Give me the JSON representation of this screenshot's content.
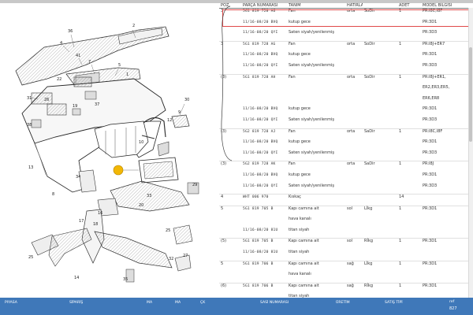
{
  "diagram": {
    "callouts": [
      "36",
      "4",
      "41",
      "7",
      "2",
      "22",
      "5",
      "1",
      "31",
      "26",
      "37",
      "19",
      "30",
      "9",
      "38",
      "12",
      "10",
      "13",
      "8",
      "34",
      "33",
      "29",
      "20",
      "17",
      "16",
      "18",
      "25",
      "25",
      "32",
      "27",
      "14",
      "35"
    ]
  },
  "table": {
    "headers": [
      "POZ.",
      "PARÇA NUMARASI",
      "TANIM",
      "HATIRLATMA",
      "",
      "ADET",
      "MODEL BİLGİSİ"
    ],
    "rows": [
      {
        "poz": "3",
        "part": "5G1 819 728 AG",
        "desc": "Fan",
        "color": "orta",
        "variant": "SoDir",
        "qty": "1",
        "model": "PR:I8C,I8F"
      },
      {
        "poz": "",
        "part": "11/16-08/20 BVQ",
        "desc": "kutup gece",
        "color": "",
        "variant": "",
        "qty": "",
        "model": "PR:3D1"
      },
      {
        "poz": "",
        "part": "11/16-08/20 QYI",
        "desc": "Saten siyah/yenilenmiş",
        "color": "",
        "variant": "",
        "qty": "",
        "model": "PR:3D3"
      },
      {
        "poz": "3",
        "part": "5G1 819 728 AG",
        "desc": "Fan",
        "color": "orta",
        "variant": "SoDir",
        "qty": "1",
        "model": "PR:I8J+ER7"
      },
      {
        "poz": "",
        "part": "11/16-08/20 BVQ",
        "desc": "kutup gece",
        "color": "",
        "variant": "",
        "qty": "",
        "model": "PR:3D1"
      },
      {
        "poz": "",
        "part": "11/16-08/20 QYI",
        "desc": "Saten siyah/yenilenmiş",
        "color": "",
        "variant": "",
        "qty": "",
        "model": "PR:3D3"
      },
      {
        "poz": "(3)",
        "part": "5G1 819 728 AH",
        "desc": "Fan",
        "color": "orta",
        "variant": "SoDir",
        "qty": "1",
        "model": "PR:I8J+ER1,"
      },
      {
        "poz": "",
        "part": "",
        "desc": "",
        "color": "",
        "variant": "",
        "qty": "",
        "model": "ER2,ER3,ER5,"
      },
      {
        "poz": "",
        "part": "",
        "desc": "",
        "color": "",
        "variant": "",
        "qty": "",
        "model": "ER6,ER8"
      },
      {
        "poz": "",
        "part": "11/16-08/20 BVQ",
        "desc": "kutup gece",
        "color": "",
        "variant": "",
        "qty": "",
        "model": "PR:3D1"
      },
      {
        "poz": "",
        "part": "11/16-08/20 QYI",
        "desc": "Saten siyah/yenilenmiş",
        "color": "",
        "variant": "",
        "qty": "",
        "model": "PR:3D3"
      },
      {
        "poz": "(3)",
        "part": "5G2 819 728 AJ",
        "desc": "Fan",
        "color": "orta",
        "variant": "SaDir",
        "qty": "1",
        "model": "PR:I8C,I8F"
      },
      {
        "poz": "",
        "part": "11/16-08/20 BVQ",
        "desc": "kutup gece",
        "color": "",
        "variant": "",
        "qty": "",
        "model": "PR:3D1"
      },
      {
        "poz": "",
        "part": "11/16-08/20 QYI",
        "desc": "Saten siyah/yenilenmiş",
        "color": "",
        "variant": "",
        "qty": "",
        "model": "PR:3D3"
      },
      {
        "poz": "(3)",
        "part": "5G2 819 728 AK",
        "desc": "Fan",
        "color": "orta",
        "variant": "SaDir",
        "qty": "1",
        "model": "PR:I8J"
      },
      {
        "poz": "",
        "part": "11/16-08/20 BVQ",
        "desc": "kutup gece",
        "color": "",
        "variant": "",
        "qty": "",
        "model": "PR:3D1"
      },
      {
        "poz": "",
        "part": "11/16-08/20 QYI",
        "desc": "Saten siyah/yenilenmiş",
        "color": "",
        "variant": "",
        "qty": "",
        "model": "PR:3D3"
      },
      {
        "poz": "4",
        "part": "WHT 006 970",
        "desc": "Kıskaç",
        "color": "",
        "variant": "",
        "qty": "14",
        "model": ""
      },
      {
        "poz": "5",
        "part": "5G1 819 705 B",
        "desc": "Kapı camına ait",
        "color": "sol",
        "variant": "Lİkg",
        "qty": "1",
        "model": "PR:3D1"
      },
      {
        "poz": "",
        "part": "",
        "desc": "hava kanalı",
        "color": "",
        "variant": "",
        "qty": "",
        "model": ""
      },
      {
        "poz": "",
        "part": "11/16-08/20 81U",
        "desc": "titan siyah",
        "color": "",
        "variant": "",
        "qty": "",
        "model": ""
      },
      {
        "poz": "(5)",
        "part": "5G1 819 705 B",
        "desc": "Kapı camına ait",
        "color": "sol",
        "variant": "Rİkg",
        "qty": "1",
        "model": "PR:3D1"
      },
      {
        "poz": "",
        "part": "11/16-08/20 81U",
        "desc": "titan siyah",
        "color": "",
        "variant": "",
        "qty": "",
        "model": ""
      },
      {
        "poz": "5",
        "part": "5G1 819 706 B",
        "desc": "Kapı camına ait",
        "color": "sağ",
        "variant": "Lİkg",
        "qty": "1",
        "model": "PR:3D1"
      },
      {
        "poz": "",
        "part": "",
        "desc": "hava kanalı",
        "color": "",
        "variant": "",
        "qty": "",
        "model": ""
      },
      {
        "poz": "(6)",
        "part": "5G1 819 706 B",
        "desc": "Kapı camına ait",
        "color": "sağ",
        "variant": "Rİkg",
        "qty": "1",
        "model": "PR:3D1"
      },
      {
        "poz": "",
        "part": "",
        "desc": "titan siyah",
        "color": "",
        "variant": "",
        "qty": "",
        "model": ""
      }
    ]
  },
  "footer": {
    "labels": [
      "PIYASA",
      "SİPARİŞ",
      "MA",
      "MA",
      "ÇK",
      "SASİ NUMARASI",
      "ÜRETİM",
      "SATIŞ TİPİ"
    ],
    "page_label": "ref",
    "page_number": "827"
  }
}
